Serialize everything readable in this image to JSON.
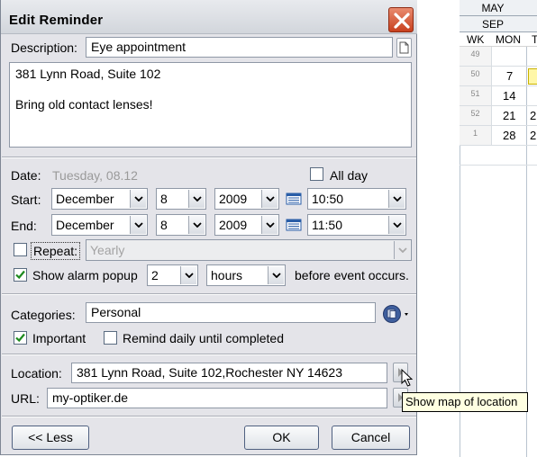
{
  "calendar": {
    "months": [
      "MAY",
      "SEP"
    ],
    "headers": {
      "wk": "WK",
      "mon": "MON",
      "tue": "T"
    },
    "weeks": [
      {
        "wk": "49",
        "mon": "",
        "tue": ""
      },
      {
        "wk": "50",
        "mon": "7",
        "tue": ""
      },
      {
        "wk": "51",
        "mon": "14",
        "tue": ""
      },
      {
        "wk": "52",
        "mon": "21",
        "tue": "2"
      },
      {
        "wk": "1",
        "mon": "28",
        "tue": "2"
      }
    ]
  },
  "dialog": {
    "title": "Edit Reminder",
    "description_label": "Description:",
    "description_value": "Eye appointment",
    "notes": [
      "381 Lynn Road, Suite 102",
      "",
      "Bring old contact lenses!"
    ],
    "date_label": "Date:",
    "date_value": "Tuesday, 08.12",
    "all_day_label": "All day",
    "start_label": "Start:",
    "end_label": "End:",
    "start": {
      "month": "December",
      "day": "8",
      "year": "2009",
      "time": "10:50"
    },
    "end": {
      "month": "December",
      "day": "8",
      "year": "2009",
      "time": "11:50"
    },
    "repeat_label": "Repeat:",
    "repeat_value": "Yearly",
    "alarm_label": "Show alarm popup",
    "alarm_amount": "2",
    "alarm_unit": "hours",
    "alarm_suffix": "before event occurs.",
    "categories_label": "Categories:",
    "categories_value": "Personal",
    "important_label": "Important",
    "remind_daily_label": "Remind daily until completed",
    "location_label": "Location:",
    "location_value": "381 Lynn Road, Suite 102,Rochester   NY 14623",
    "url_label": "URL:",
    "url_value": "my-optiker.de",
    "less_button": "<< Less",
    "ok_button": "OK",
    "cancel_button": "Cancel",
    "tooltip": "Show map of location"
  },
  "colors": {
    "dialog_bg": "#e4e4e9",
    "close_button": "#c8401e",
    "check_green": "#1e8a1e",
    "tooltip_bg": "#ffffe1"
  }
}
